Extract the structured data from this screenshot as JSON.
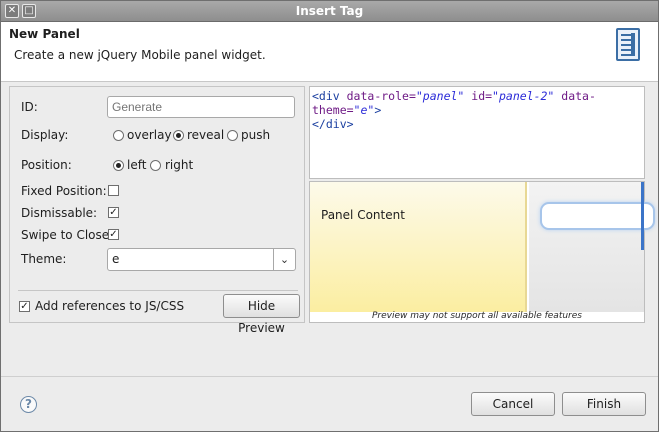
{
  "window": {
    "title": "Insert Tag"
  },
  "header": {
    "title": "New Panel",
    "description": "Create a new jQuery Mobile panel widget.",
    "icon": "panel-widget-icon"
  },
  "form": {
    "id_label": "ID:",
    "id_placeholder": "Generate",
    "display_label": "Display:",
    "display_options": [
      "overlay",
      "reveal",
      "push"
    ],
    "display_selected": "reveal",
    "position_label": "Position:",
    "position_options": [
      "left",
      "right"
    ],
    "position_selected": "left",
    "fixed_label": "Fixed Position:",
    "fixed_checked": false,
    "dismissable_label": "Dismissable:",
    "dismissable_checked": true,
    "swipe_label": "Swipe to Close:",
    "swipe_checked": true,
    "theme_label": "Theme:",
    "theme_value": "e",
    "add_refs_label": "Add references to JS/CSS",
    "add_refs_checked": true,
    "hide_preview_label": "Hide Preview"
  },
  "code": {
    "open": "<div",
    "attr1": " data-role=",
    "val1": "\"panel\"",
    "attr2": " id=",
    "val2": "\"panel-2\"",
    "attr3": " data-theme=",
    "val3": "\"e\"",
    "gt": ">",
    "close": "</div>"
  },
  "preview": {
    "panel_content": "Panel Content",
    "note": "Preview may not support all available features"
  },
  "buttons": {
    "cancel": "Cancel",
    "finish": "Finish"
  },
  "colors": {
    "panel_bg": "#fbeea1",
    "accent": "#3b74c8"
  }
}
